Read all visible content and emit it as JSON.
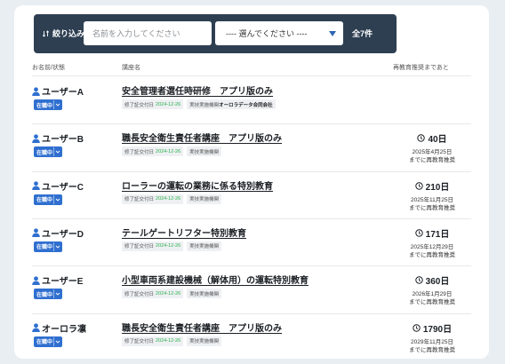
{
  "filter": {
    "label": "絞り込み",
    "name_placeholder": "名前を入力してください",
    "select_value": "---- 選んでください ----",
    "count": "全7件"
  },
  "headers": {
    "name": "お名前/状態",
    "course": "講座名",
    "due": "再教育推奨まであと"
  },
  "rows": [
    {
      "user": "ユーザーA",
      "status": "在職中",
      "course": "安全管理者選任時研修　アプリ版のみ",
      "issue_label": "修了証交付日",
      "issue_date": "2024-12-26",
      "org_label": "実技実施機関",
      "org_name": "オーロラデータ合同会社",
      "days": "",
      "due_date": "",
      "due_note": ""
    },
    {
      "user": "ユーザーB",
      "status": "在職中",
      "course": "職長安全衛生責任者講座　アプリ版のみ",
      "issue_label": "修了証交付日",
      "issue_date": "2024-12-26",
      "org_label": "実技実施機関",
      "org_name": "",
      "days": "40日",
      "due_date": "2025年4月25日",
      "due_note": "までに再教育推奨"
    },
    {
      "user": "ユーザーC",
      "status": "在職中",
      "course": "ローラーの運転の業務に係る特別教育",
      "issue_label": "修了証交付日",
      "issue_date": "2024-12-26",
      "org_label": "実技実施機関",
      "org_name": "",
      "days": "210日",
      "due_date": "2025年11月25日",
      "due_note": "までに再教育推奨"
    },
    {
      "user": "ユーザーD",
      "status": "在職中",
      "course": "テールゲートリフター特別教育",
      "issue_label": "修了証交付日",
      "issue_date": "2024-12-26",
      "org_label": "実技実施機関",
      "org_name": "",
      "days": "171日",
      "due_date": "2025年12月29日",
      "due_note": "までに再教育推奨"
    },
    {
      "user": "ユーザーE",
      "status": "在職中",
      "course": "小型車両系建設機械（解体用）の運転特別教育",
      "issue_label": "修了証交付日",
      "issue_date": "2024-12-26",
      "org_label": "実技実施機関",
      "org_name": "",
      "days": "360日",
      "due_date": "2026年1月29日",
      "due_note": "までに再教育推奨"
    },
    {
      "user": "オーロラ凛",
      "status": "在職中",
      "course": "職長安全衛生責任者講座　アプリ版のみ",
      "issue_label": "修了証交付日",
      "issue_date": "2024-12-26",
      "org_label": "実技実施機関",
      "org_name": "",
      "days": "1790日",
      "due_date": "2029年11月25日",
      "due_note": "までに再教育推奨"
    }
  ],
  "colors": {
    "filter_bg": "#2e3f52",
    "status_bg": "#2f6fd0",
    "date_green": "#2bb24c",
    "page_bg": "#e9eef3"
  }
}
